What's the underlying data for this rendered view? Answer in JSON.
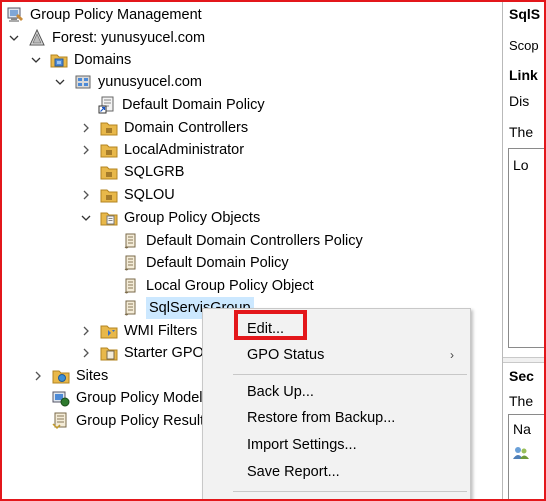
{
  "tree": {
    "root": "Group Policy Management",
    "forest": "Forest: yunusyucel.com",
    "domains": "Domains",
    "domain": "yunusyucel.com",
    "default_domain_policy": "Default Domain Policy",
    "domain_controllers": "Domain Controllers",
    "local_administrator": "LocalAdministrator",
    "sqlgrb": "SQLGRB",
    "sqlou": "SQLOU",
    "gpo_folder": "Group Policy Objects",
    "gpo_items": [
      "Default Domain Controllers Policy",
      "Default Domain Policy",
      "Local Group Policy Object",
      "SqlServisGroup"
    ],
    "wmi_filters": "WMI Filters",
    "starter_gpos": "Starter GPOs",
    "sites": "Sites",
    "gp_modeling": "Group Policy Modeling",
    "gp_results": "Group Policy Results"
  },
  "right_pane": {
    "title": "SqlS",
    "scope": "Scop",
    "links": "Link",
    "display": "Dis",
    "the1": "The",
    "box_text": "Lo",
    "security": "Sec",
    "the2": "The",
    "name": "Na"
  },
  "context_menu": {
    "items": [
      "Edit...",
      "GPO Status",
      "Back Up...",
      "Restore from Backup...",
      "Import Settings...",
      "Save Report..."
    ]
  },
  "colors": {
    "highlight_border": "#e3171b",
    "selection": "#cce8ff",
    "menu_bg": "#f2f2f2"
  }
}
